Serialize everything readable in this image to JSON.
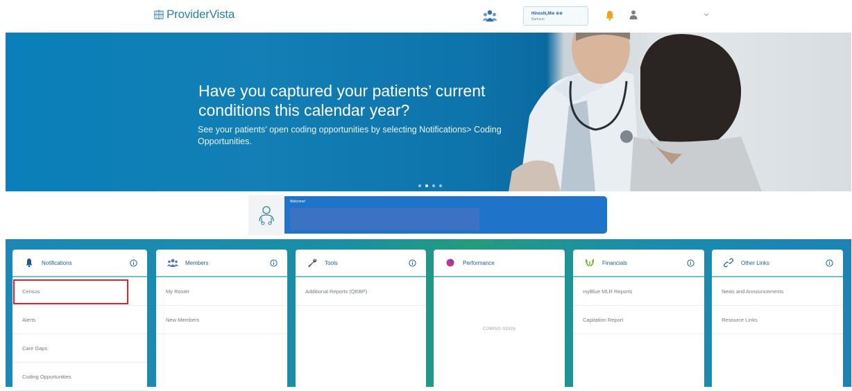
{
  "brand": {
    "name": "ProviderVista",
    "color": "#2a7fa8"
  },
  "header": {
    "user_name": "Hinoxlk,Mie ⊕⊕",
    "user_sub": "Barhsun",
    "icons": [
      "org-icon",
      "bell-icon",
      "person-icon",
      "chevron-down-icon"
    ]
  },
  "banner": {
    "headline": "Have you captured your patients’ current conditions this calendar year?",
    "subline": "See your patients’ open coding opportunities by selecting Notifications> Coding Opportunities.",
    "slides": [
      {
        "active": false
      },
      {
        "active": true
      },
      {
        "active": false
      },
      {
        "active": false
      }
    ]
  },
  "welcome": {
    "label": "Welcome!",
    "name": ""
  },
  "panels": [
    {
      "title": "Notifications",
      "icon": "bell-icon",
      "items": [
        "Census",
        "Alerts",
        "Care Gaps",
        "Coding Opportunities"
      ]
    },
    {
      "title": "Members",
      "icon": "members-icon",
      "items": [
        "My Roster",
        "New Members"
      ]
    },
    {
      "title": "Tools",
      "icon": "wrench-icon",
      "items": [
        "Additional Reports (QEBP)"
      ]
    },
    {
      "title": "Performance",
      "icon": "pie-chart-icon",
      "items": [],
      "empty_text": "COMING SOON"
    },
    {
      "title": "Financials",
      "icon": "laurel-icon",
      "items": [
        "myBlue MLR Reports",
        "Capitation Report"
      ]
    },
    {
      "title": "Other Links",
      "icon": "link-icon",
      "items": [
        "News and Announcements",
        "Resource Links"
      ]
    }
  ],
  "highlighted_item": "Census",
  "colors": {
    "accent": "#1e74c9",
    "highlight": "#e51f2a",
    "panel_rule": "#69c1d2"
  }
}
